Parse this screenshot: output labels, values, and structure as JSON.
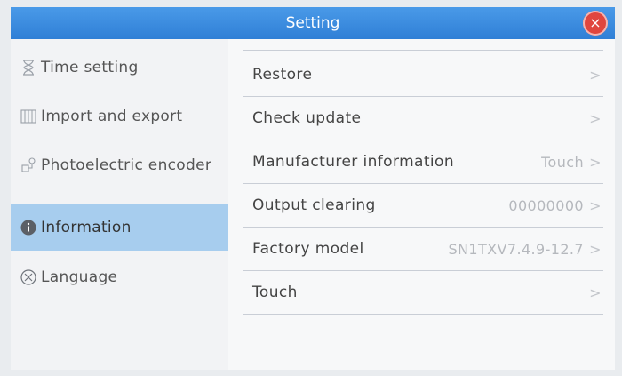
{
  "window": {
    "title": "Setting",
    "close_label": "×"
  },
  "sidebar": {
    "items": [
      {
        "label": "Time setting",
        "icon": "hourglass-icon",
        "active": false
      },
      {
        "label": "Import and export",
        "icon": "import-export-icon",
        "active": false
      },
      {
        "label": "Photoelectric encoder",
        "icon": "encoder-icon",
        "active": false
      },
      {
        "label": "Information",
        "icon": "info-icon",
        "active": true
      },
      {
        "label": "Language",
        "icon": "language-icon",
        "active": false
      }
    ]
  },
  "content": {
    "rows": [
      {
        "label": "Restore",
        "value": "",
        "chevron": ">"
      },
      {
        "label": "Check update",
        "value": "",
        "chevron": ">"
      },
      {
        "label": "Manufacturer information",
        "value": "Touch",
        "chevron": ">"
      },
      {
        "label": "Output clearing",
        "value": "00000000",
        "chevron": ">"
      },
      {
        "label": "Factory model",
        "value": "SN1TXV7.4.9-12.7",
        "chevron": ">"
      },
      {
        "label": "Touch",
        "value": "",
        "chevron": ">"
      }
    ]
  },
  "colors": {
    "titlebar": "#2f7fd6",
    "active_item": "#a7cdee",
    "close_button": "#e0463e"
  }
}
